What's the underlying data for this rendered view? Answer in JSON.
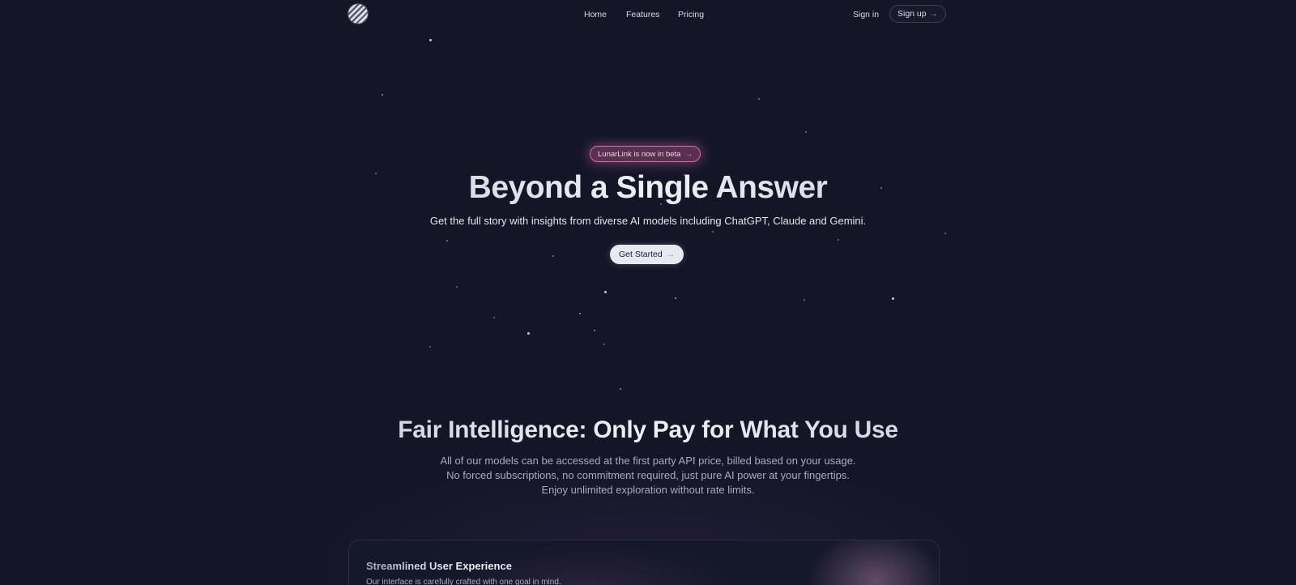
{
  "nav": {
    "links": [
      {
        "label": "Home"
      },
      {
        "label": "Features"
      },
      {
        "label": "Pricing"
      }
    ],
    "sign_in": "Sign in",
    "sign_up": "Sign up",
    "arrow": "→"
  },
  "hero": {
    "badge": "LunarLink is now in beta",
    "title": "Beyond a Single Answer",
    "subtitle": "Get the full story with insights from diverse AI models including ChatGPT, Claude and Gemini.",
    "cta": "Get Started"
  },
  "pricing": {
    "title": "Fair Intelligence: Only Pay for What You Use",
    "lines": [
      "All of our models can be accessed at the first party API price, billed based on your usage.",
      "No forced subscriptions, no commitment required, just pure AI power at your fingertips.",
      "Enjoy unlimited exploration without rate limits."
    ]
  },
  "feature_card": {
    "title": "Streamlined User Experience",
    "subtitle": "Our interface is carefully crafted with one goal in mind."
  },
  "colors": {
    "background": "#141628",
    "accent_pink": "#d56aa6",
    "button_light": "#e8e9f0"
  }
}
